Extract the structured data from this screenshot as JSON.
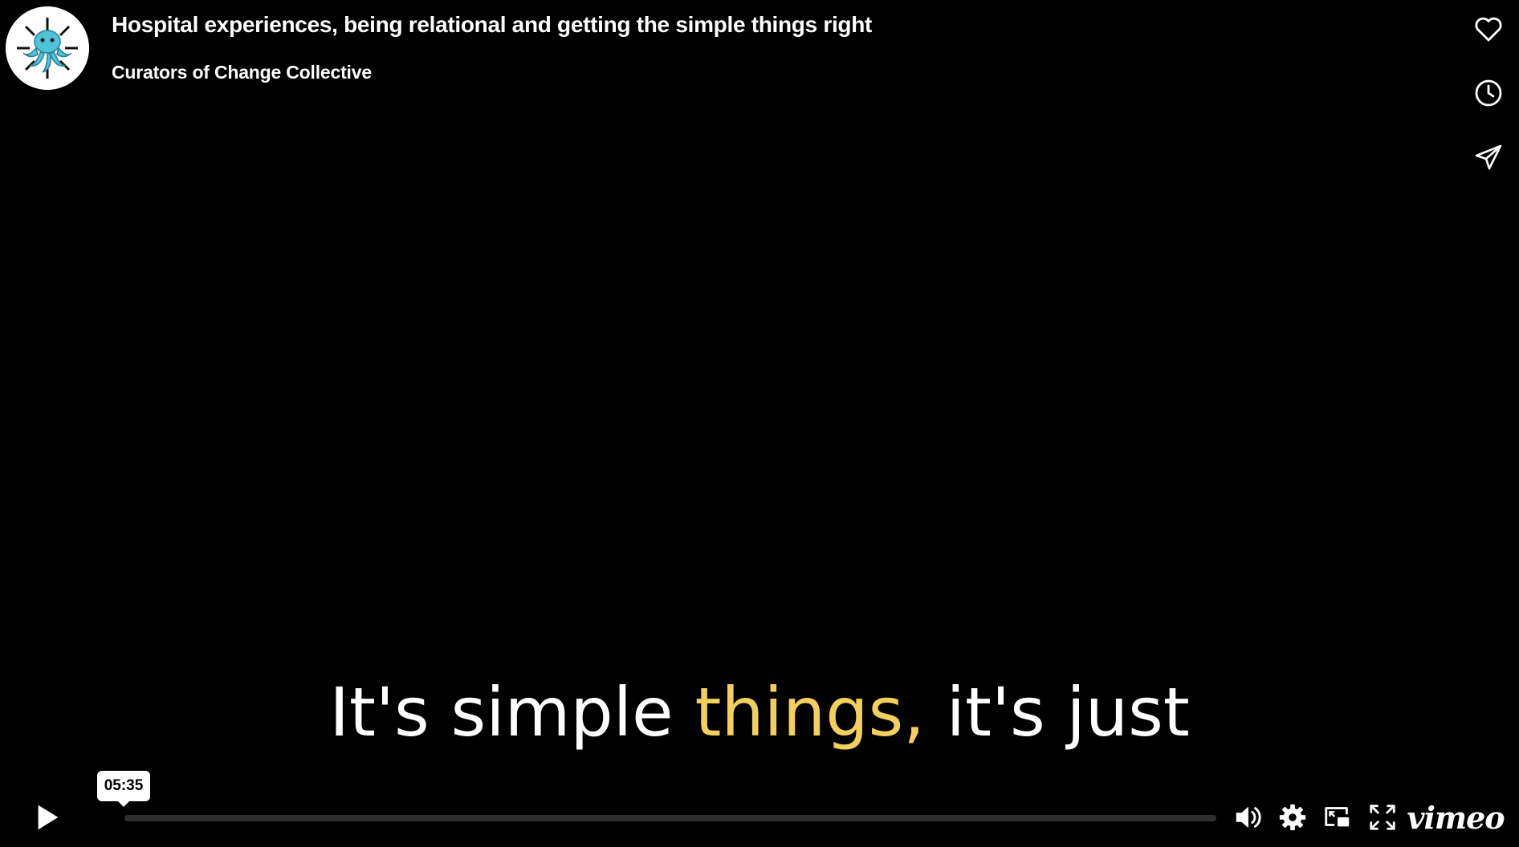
{
  "video": {
    "title": "Hospital experiences, being relational and getting the simple things right",
    "channel": "Curators of Change Collective"
  },
  "side_actions": [
    {
      "name": "like",
      "icon": "heart-icon"
    },
    {
      "name": "watch-later",
      "icon": "clock-icon"
    },
    {
      "name": "share",
      "icon": "paper-plane-icon"
    }
  ],
  "caption": {
    "before": "It's simple ",
    "highlight": "things,",
    "after": " it's just",
    "text_color": "#ffffff",
    "highlight_color": "#f3cf5d"
  },
  "controls": {
    "play_icon": "play-icon",
    "hover_time": "05:35",
    "progress_fraction": 0,
    "volume_icon": "volume-icon",
    "settings_icon": "gear-icon",
    "pip_icon": "picture-in-picture-icon",
    "fullscreen_icon": "fullscreen-icon",
    "brand": "vimeo"
  },
  "colors": {
    "background": "#000000",
    "track": "#2f2f2f",
    "foreground": "#ffffff"
  }
}
